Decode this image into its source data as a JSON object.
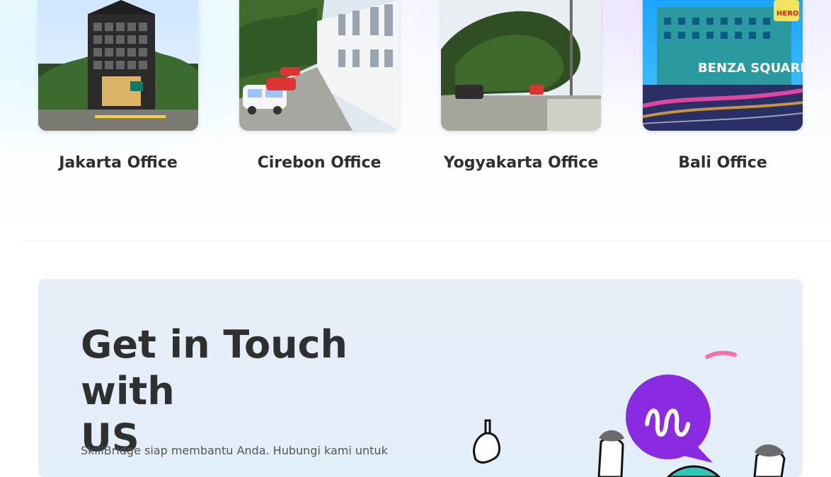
{
  "offices": [
    {
      "label": "Jakarta Office",
      "icon": "office-building-photo"
    },
    {
      "label": "Cirebon Office",
      "icon": "office-street-photo"
    },
    {
      "label": "Yogyakarta Office",
      "icon": "office-trees-photo"
    },
    {
      "label": "Bali Office",
      "icon": "office-square-photo"
    }
  ],
  "photo_signage": {
    "bali_sign": "BENZA SQUARE",
    "bali_store": "HERO"
  },
  "contact": {
    "title_line1": "Get in Touch with",
    "title_line2": "US",
    "description": "SkillBridge siap membantu Anda. Hubungi kami untuk"
  },
  "colors": {
    "card_bg": "#e4eef8",
    "accent_purple": "#8a2be2",
    "accent_pink": "#ff6fa6",
    "accent_teal": "#2ec4b6",
    "accent_blue": "#2196f3",
    "text_dark": "#2f2f2f"
  }
}
